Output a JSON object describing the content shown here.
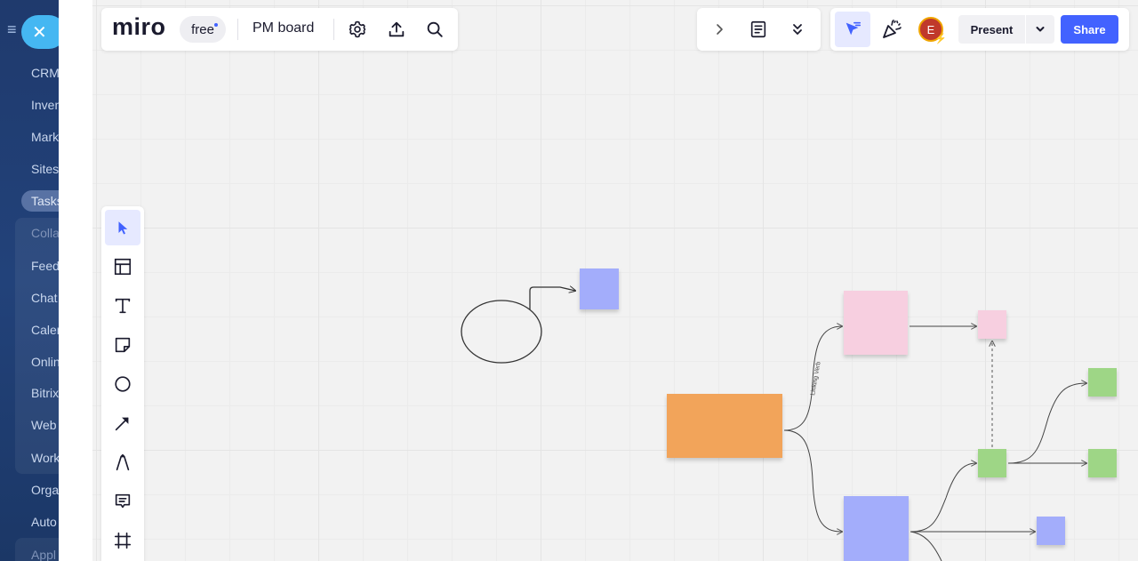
{
  "host_sidebar": {
    "items": [
      "CRM",
      "Inven",
      "Mark",
      "Sites",
      "Tasks",
      "Colla",
      "Feed",
      "Chat",
      "Calen",
      "Onlin",
      "Bitrix",
      "Web",
      "Work",
      "Orga",
      "Auto",
      "Appl"
    ]
  },
  "header": {
    "logo": "miro",
    "plan_badge": "free",
    "board_name": "PM board"
  },
  "right_toolbar": {
    "avatar_initial": "E",
    "present_label": "Present",
    "share_label": "Share"
  },
  "board": {
    "connector_label": "Linking Verb"
  },
  "colors": {
    "accent": "#4262ff",
    "sticky_purple": "#a3adfb",
    "sticky_pink": "#f7cfe0",
    "sticky_orange": "#f2a45a",
    "sticky_green": "#9ed686"
  },
  "icons": {
    "settings": "gear-icon",
    "export": "upload-icon",
    "search": "search-icon",
    "chevron": "chevron-right-icon",
    "notes": "document-icon",
    "collapse": "double-chevron-down-icon",
    "cursor": "cursor-icon",
    "reactions": "party-popper-icon",
    "tools": [
      "select-icon",
      "templates-icon",
      "text-icon",
      "sticky-note-icon",
      "shape-icon",
      "arrow-icon",
      "pen-icon",
      "comment-icon",
      "frame-icon"
    ]
  }
}
